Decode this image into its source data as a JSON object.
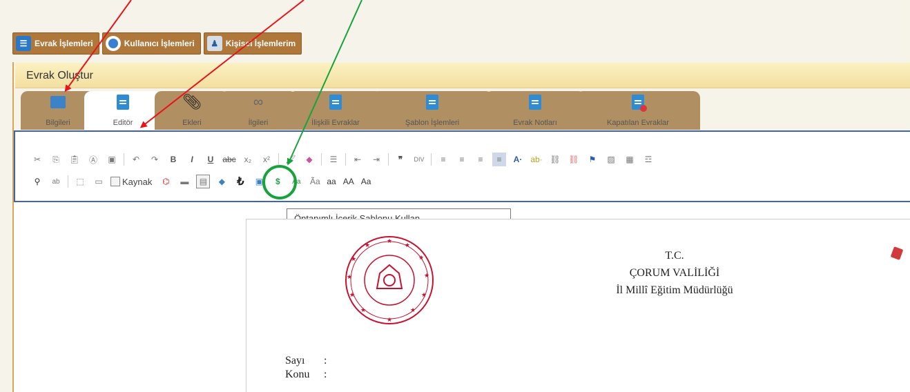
{
  "top_tabs": [
    {
      "label": "Evrak İşlemleri",
      "icon": "document-icon"
    },
    {
      "label": "Kullanıcı İşlemleri",
      "icon": "user-icon"
    },
    {
      "label": "Kişisel İşlemlerim",
      "icon": "personal-icon"
    }
  ],
  "page_title": "Evrak Oluştur",
  "doc_tabs": [
    {
      "label": "Bilgileri",
      "icon": "info-icon"
    },
    {
      "label": "Editör",
      "icon": "editor-icon",
      "active": true
    },
    {
      "label": "Ekleri",
      "icon": "paperclip-icon"
    },
    {
      "label": "İlgileri",
      "icon": "link-icon"
    },
    {
      "label": "İlişkili Evraklar",
      "icon": "related-docs-icon"
    },
    {
      "label": "Şablon İşlemleri",
      "icon": "template-icon"
    },
    {
      "label": "Evrak Notları",
      "icon": "notes-icon"
    },
    {
      "label": "Kapatılan Evraklar",
      "icon": "closed-docs-icon"
    }
  ],
  "toolbar": {
    "source_label": "Kaynak",
    "case_lower": "aa",
    "case_upper": "AA",
    "case_title": "Aa"
  },
  "tooltip": "Öntanımlı İçerik Şablonu Kullan",
  "letterhead": {
    "line1": "T.C.",
    "line2": "ÇORUM VALİLİĞİ",
    "line3": "İl Millî Eğitim Müdürlüğü"
  },
  "fields": {
    "sayi_label": "Sayı",
    "konu_label": "Konu",
    "colon": ":"
  },
  "colors": {
    "tab_brown": "#b0773b",
    "toolbar_border": "#3f63b3",
    "annotation_red": "#e8141a",
    "annotation_green": "#17a33b"
  }
}
